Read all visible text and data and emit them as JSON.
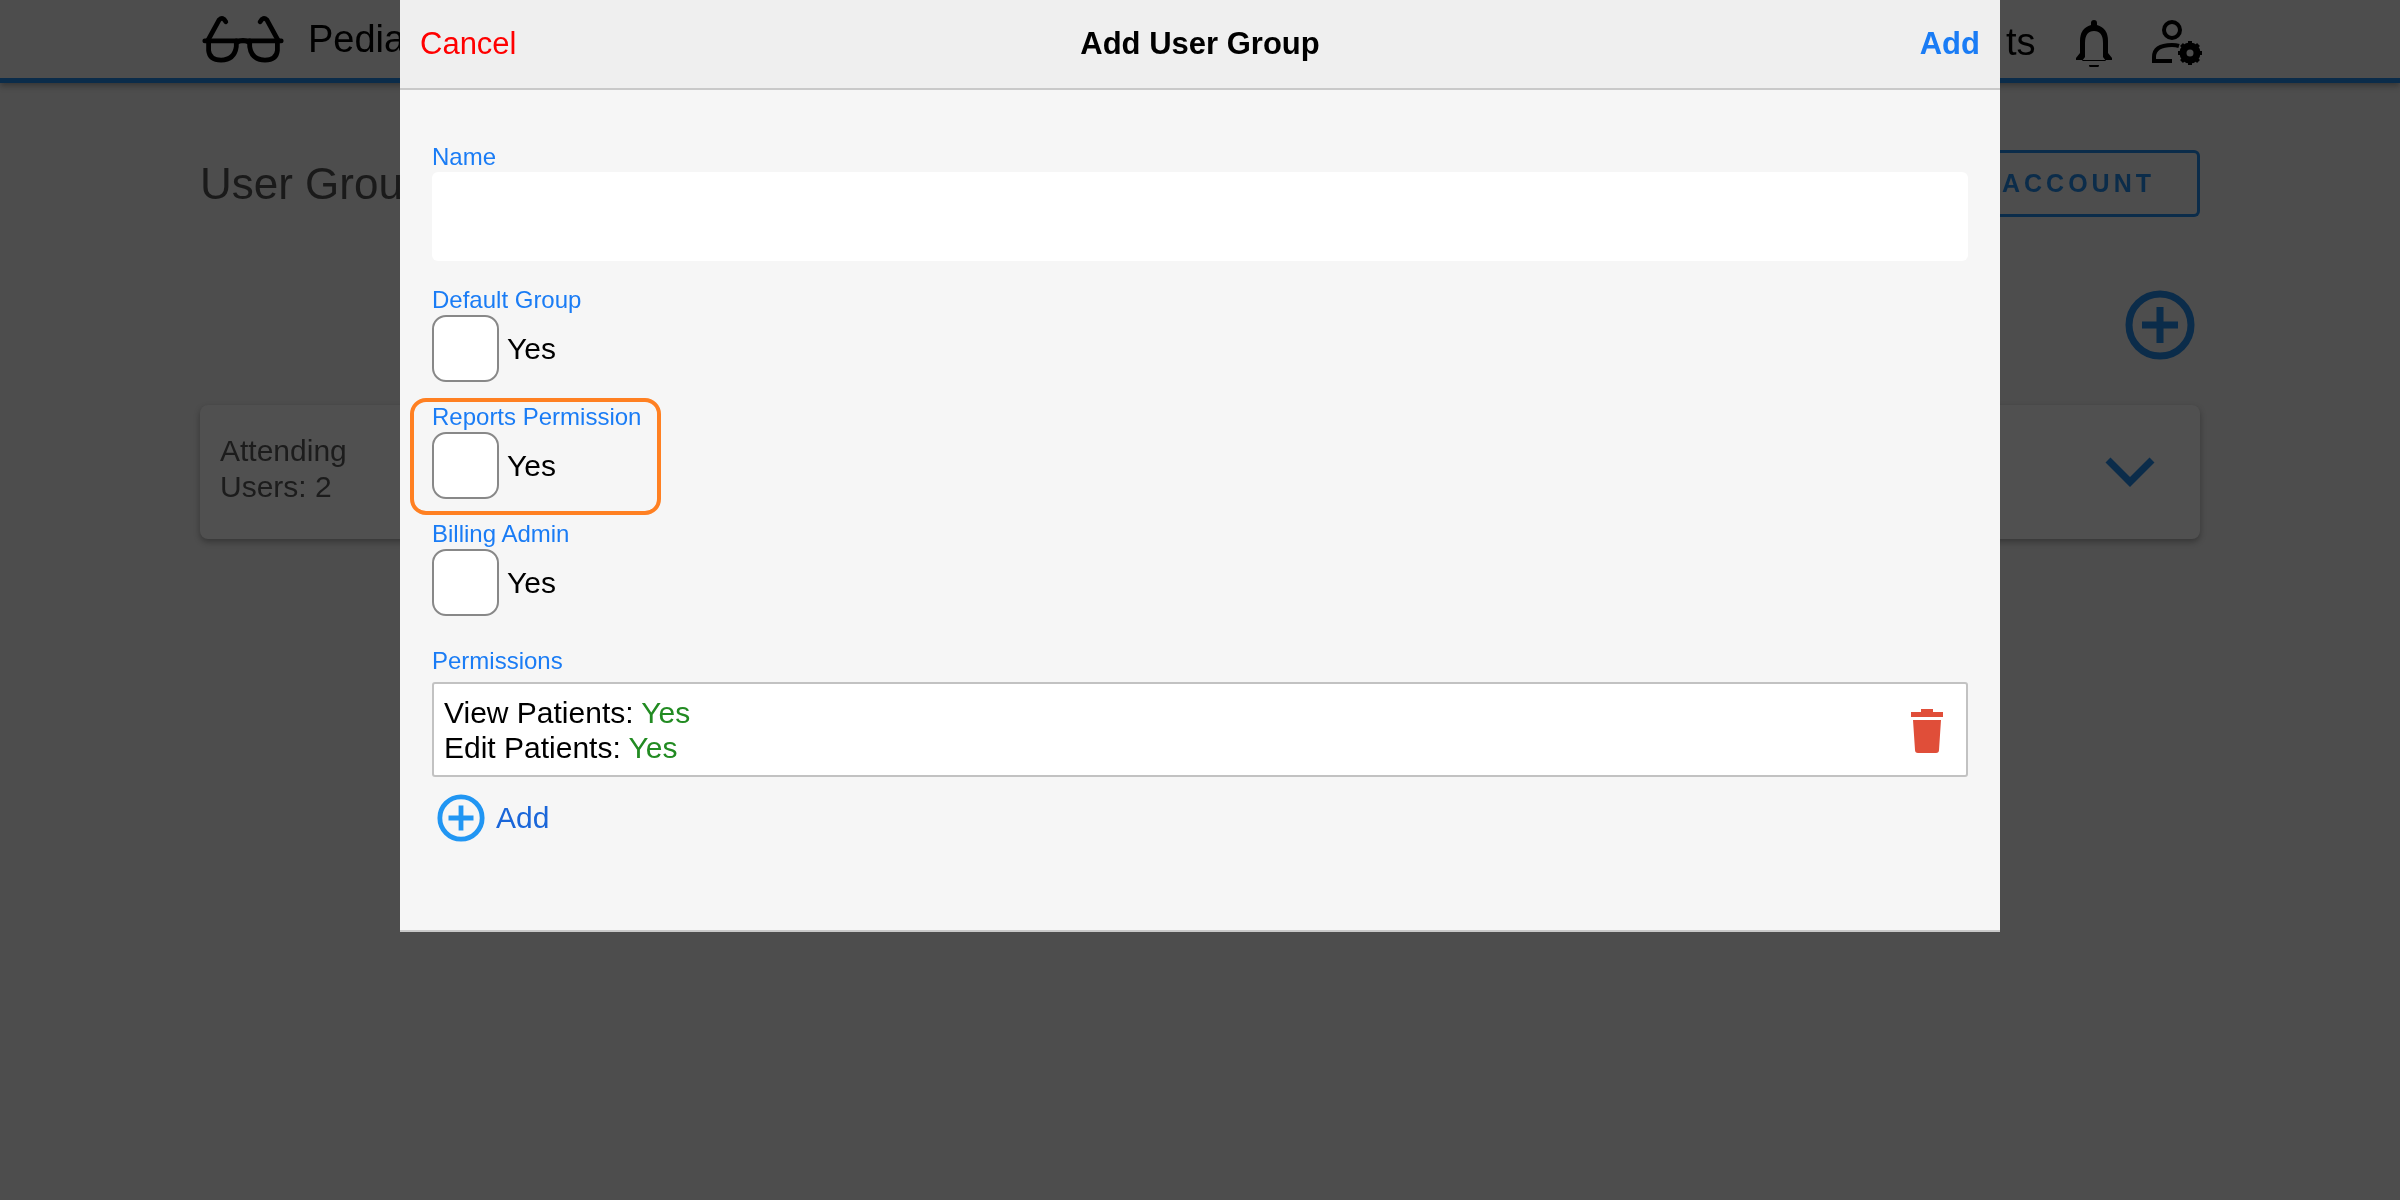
{
  "app_header": {
    "brand": "Pedia",
    "nav_text": "ts"
  },
  "page": {
    "title": "User Grou",
    "account_button": "ACCOUNT",
    "groups": [
      {
        "name": "Attending",
        "users": "Users: 2",
        "expanded": false
      }
    ]
  },
  "dialog": {
    "cancel": "Cancel",
    "title": "Add User Group",
    "confirm": "Add",
    "fields": [
      {
        "kind": "text",
        "label": "Name"
      },
      {
        "kind": "checkbox",
        "label": "Default Group",
        "option": "Yes",
        "checked": false,
        "highlighted": false
      },
      {
        "kind": "checkbox",
        "label": "Reports Permission",
        "option": "Yes",
        "checked": false,
        "highlighted": true
      },
      {
        "kind": "checkbox",
        "label": "Billing Admin",
        "option": "Yes",
        "checked": false,
        "highlighted": false
      },
      {
        "kind": "list",
        "label": "Permissions",
        "add_label": "Add",
        "items": [
          {
            "name": "View Patients:",
            "value": "Yes"
          },
          {
            "name": "Edit Patients:",
            "value": "Yes"
          }
        ]
      }
    ]
  }
}
